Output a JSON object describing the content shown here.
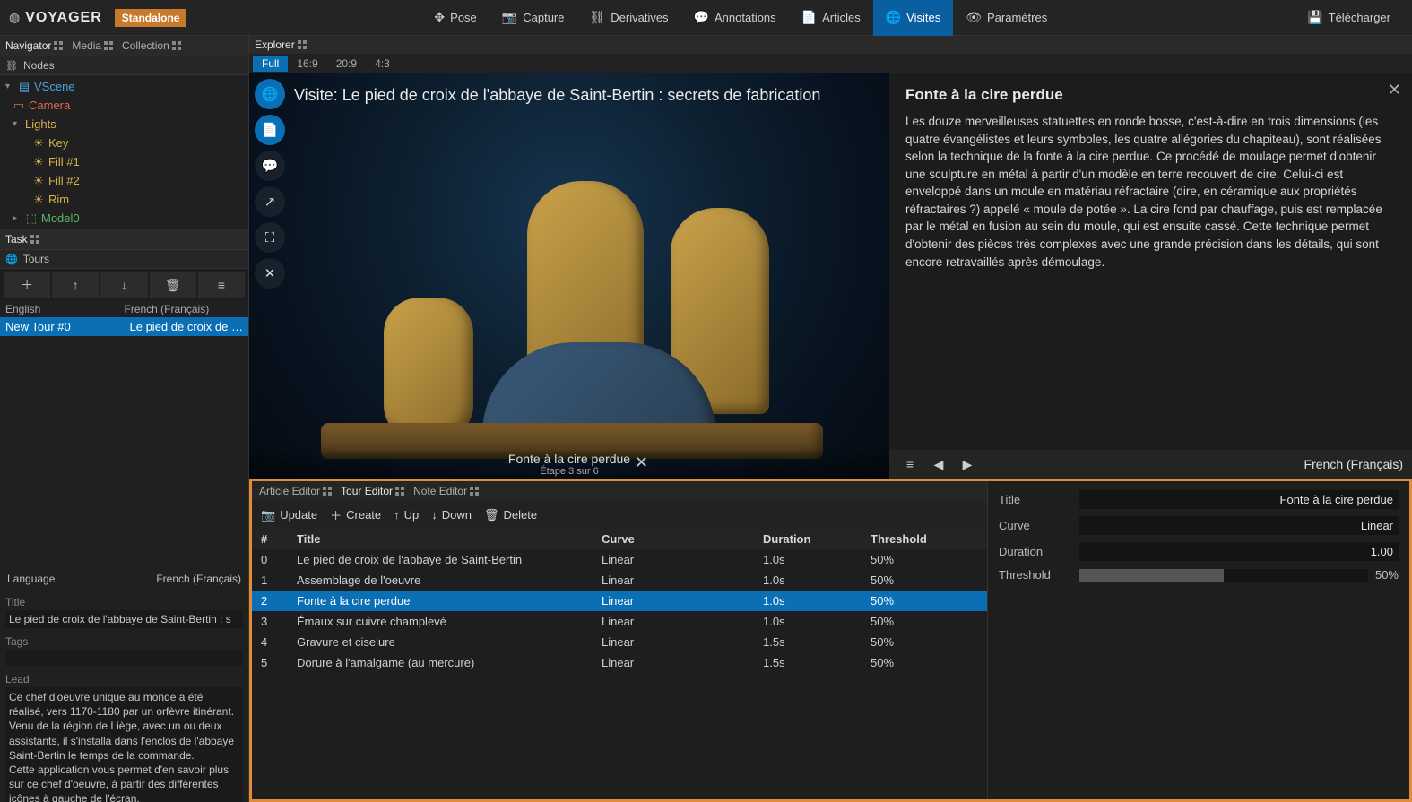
{
  "app": {
    "name": "VOYAGER",
    "mode": "Standalone"
  },
  "menubar": {
    "items": [
      {
        "label": "Pose",
        "icon": "✥"
      },
      {
        "label": "Capture",
        "icon": "📷"
      },
      {
        "label": "Derivatives",
        "icon": "⛓"
      },
      {
        "label": "Annotations",
        "icon": "💬"
      },
      {
        "label": "Articles",
        "icon": "📄"
      },
      {
        "label": "Visites",
        "icon": "🌐",
        "active": true
      },
      {
        "label": "Paramètres",
        "icon": "👁"
      }
    ],
    "download": "Télécharger"
  },
  "left": {
    "panels": {
      "navigator": "Navigator",
      "media": "Media",
      "collection": "Collection"
    },
    "nodes_header": "Nodes",
    "tree": {
      "vscene": "VScene",
      "camera": "Camera",
      "lights": "Lights",
      "key": "Key",
      "fill1": "Fill #1",
      "fill2": "Fill #2",
      "rim": "Rim",
      "model": "Model0"
    },
    "task_header": "Task",
    "tours_header": "Tours",
    "lang_en": "English",
    "lang_fr": "French (Français)",
    "tour_en": "New Tour #0",
    "tour_fr": "Le pied de croix de l'a…",
    "props": {
      "language_label": "Language",
      "language_value": "French (Français)",
      "title_label": "Title",
      "title_value": "Le pied de croix de l'abbaye de Saint-Bertin : s",
      "tags_label": "Tags",
      "tags_value": "",
      "lead_label": "Lead",
      "lead_value": "Ce chef d'oeuvre unique au monde a été réalisé, vers 1170-1180 par un orfèvre itinérant. Venu de la région de Liège, avec un ou deux assistants, il s'installa dans l'enclos de l'abbaye Saint-Bertin le temps de la commande.\nCette application vous permet d'en savoir plus sur ce chef d'oeuvre, à partir des différentes icônes à gauche de l'écran."
    }
  },
  "explorer": {
    "header": "Explorer",
    "ratios": [
      "Full",
      "16:9",
      "20:9",
      "4:3"
    ],
    "active_ratio": "Full",
    "tour_title": "Visite: Le pied de croix de l'abbaye de Saint-Bertin : secrets de fabrication",
    "step_title": "Fonte à la cire perdue",
    "step_sub": "Étape 3 sur 6"
  },
  "reader": {
    "title": "Fonte à la cire perdue",
    "body": "Les douze merveilleuses statuettes en ronde bosse, c'est-à-dire en trois dimensions (les quatre évangélistes et leurs symboles, les quatre allégories du chapiteau), sont réalisées selon la technique de la fonte à la cire perdue. Ce procédé de moulage permet d'obtenir une sculpture en métal à partir d'un modèle en terre recouvert de cire. Celui-ci est enveloppé dans un moule en matériau réfractaire (dire, en céramique aux propriétés réfractaires ?) appelé « moule de potée ». La cire fond par chauffage, puis est remplacée par le métal en fusion au sein du moule, qui est ensuite cassé. Cette technique permet d'obtenir des pièces très complexes avec une grande précision dans les détails, qui sont encore retravaillés après démoulage.",
    "footer_lang": "French (Français)"
  },
  "editor": {
    "tabs": {
      "article": "Article Editor",
      "tour": "Tour Editor",
      "note": "Note Editor"
    },
    "toolbar": {
      "update": "Update",
      "create": "Create",
      "up": "Up",
      "down": "Down",
      "delete": "Delete"
    },
    "columns": {
      "idx": "#",
      "title": "Title",
      "curve": "Curve",
      "duration": "Duration",
      "threshold": "Threshold"
    },
    "rows": [
      {
        "idx": "0",
        "title": "Le pied de croix de l'abbaye de Saint-Bertin",
        "curve": "Linear",
        "duration": "1.0s",
        "threshold": "50%"
      },
      {
        "idx": "1",
        "title": "Assemblage de l'oeuvre",
        "curve": "Linear",
        "duration": "1.0s",
        "threshold": "50%"
      },
      {
        "idx": "2",
        "title": "Fonte à la cire perdue",
        "curve": "Linear",
        "duration": "1.0s",
        "threshold": "50%"
      },
      {
        "idx": "3",
        "title": "Émaux sur cuivre champlevé",
        "curve": "Linear",
        "duration": "1.0s",
        "threshold": "50%"
      },
      {
        "idx": "4",
        "title": "Gravure et ciselure",
        "curve": "Linear",
        "duration": "1.5s",
        "threshold": "50%"
      },
      {
        "idx": "5",
        "title": "Dorure à l'amalgame (au mercure)",
        "curve": "Linear",
        "duration": "1.5s",
        "threshold": "50%"
      }
    ],
    "selected_idx": "2",
    "inspector": {
      "title_label": "Title",
      "title_value": "Fonte à la cire perdue",
      "curve_label": "Curve",
      "curve_value": "Linear",
      "duration_label": "Duration",
      "duration_value": "1.00",
      "threshold_label": "Threshold",
      "threshold_value": "50%"
    }
  }
}
